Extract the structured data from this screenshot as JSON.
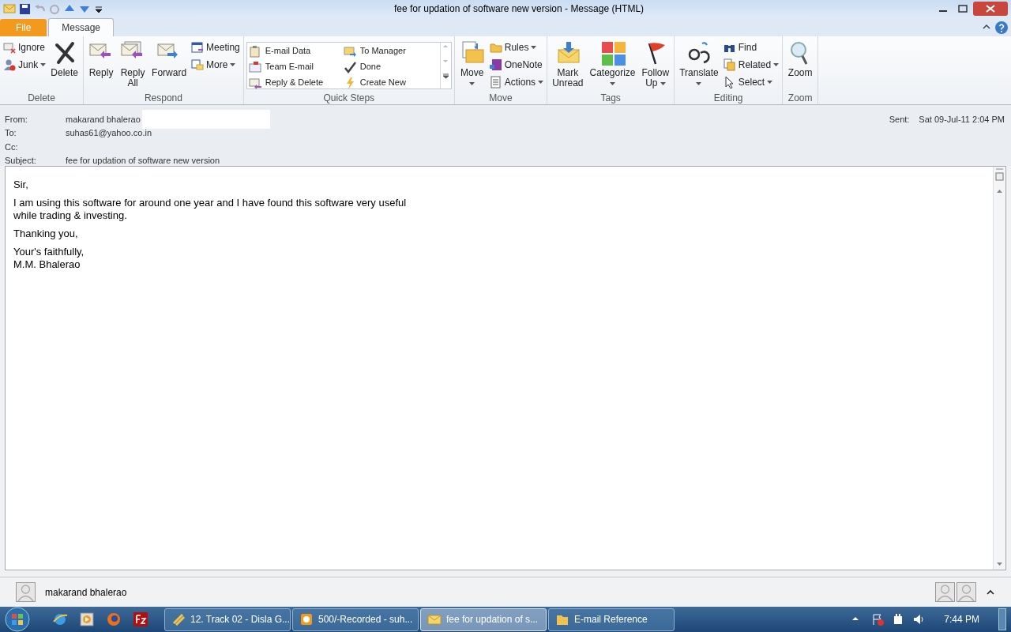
{
  "window": {
    "title": "fee for updation of software new version  -  Message (HTML)"
  },
  "tabs": [
    {
      "label": "File",
      "kind": "file",
      "selected": false
    },
    {
      "label": "Message",
      "kind": "tab",
      "selected": true
    }
  ],
  "ribbon_groups": [
    {
      "label": "Delete",
      "entries": [
        {
          "kind": "stack",
          "items": [
            {
              "label": "Ignore",
              "dropdown": false
            },
            {
              "label": "Junk",
              "dropdown": true
            }
          ]
        },
        {
          "kind": "big",
          "label": "Delete",
          "dropdown": false
        }
      ]
    },
    {
      "label": "Respond",
      "entries": [
        {
          "kind": "big",
          "label": "Reply",
          "dropdown": false
        },
        {
          "kind": "big",
          "label": "Reply All",
          "dropdown": false
        },
        {
          "kind": "big",
          "label": "Forward",
          "dropdown": false
        },
        {
          "kind": "stack",
          "items": [
            {
              "label": "Meeting",
              "dropdown": false
            },
            {
              "label": "More",
              "dropdown": true
            }
          ]
        }
      ]
    },
    {
      "label": "Quick Steps",
      "entries": [
        {
          "kind": "gallery",
          "items": [
            {
              "label": "E-mail Data"
            },
            {
              "label": "To Manager"
            },
            {
              "label": "Team E-mail"
            },
            {
              "label": "Done"
            },
            {
              "label": "Reply & Delete"
            },
            {
              "label": "Create New"
            }
          ]
        }
      ]
    },
    {
      "label": "Move",
      "entries": [
        {
          "kind": "big",
          "label": "Move",
          "dropdown": true
        },
        {
          "kind": "stack",
          "items": [
            {
              "label": "Rules",
              "dropdown": true
            },
            {
              "label": "OneNote",
              "dropdown": false
            },
            {
              "label": "Actions",
              "dropdown": true
            }
          ]
        }
      ]
    },
    {
      "label": "Tags",
      "entries": [
        {
          "kind": "big",
          "label": "Mark Unread",
          "dropdown": false
        },
        {
          "kind": "big",
          "label": "Categorize",
          "dropdown": true
        },
        {
          "kind": "big",
          "label": "Follow Up",
          "dropdown": true
        }
      ]
    },
    {
      "label": "Editing",
      "entries": [
        {
          "kind": "big",
          "label": "Translate",
          "dropdown": true
        },
        {
          "kind": "stack",
          "items": [
            {
              "label": "Find",
              "dropdown": false
            },
            {
              "label": "Related",
              "dropdown": true
            },
            {
              "label": "Select",
              "dropdown": true
            }
          ]
        }
      ]
    },
    {
      "label": "Zoom",
      "entries": [
        {
          "kind": "big",
          "label": "Zoom",
          "dropdown": false
        }
      ]
    }
  ],
  "header": {
    "fields": [
      {
        "label": "From:",
        "value": "makarand bhalerao"
      },
      {
        "label": "To:",
        "value": "suhas61@yahoo.co.in"
      },
      {
        "label": "Cc:"
      },
      {
        "label": "Subject:",
        "value": "fee for updation of software new version"
      }
    ],
    "sent": {
      "label": "Sent:",
      "value": "Sat 09-Jul-11 2:04 PM"
    }
  },
  "body": [
    [
      "Sir,"
    ],
    [
      "I am using this software for around one year and I have found this software very useful",
      "while trading & investing."
    ],
    [
      "Thanking you,"
    ],
    [
      "Your's faithfully,",
      "M.M. Bhalerao"
    ]
  ],
  "people_pane": {
    "name": "makarand bhalerao"
  },
  "taskbar": {
    "tasks": [
      {
        "label": "12. Track 02 - Disla G...",
        "selected": false
      },
      {
        "label": "500/-Recorded - suh...",
        "selected": false
      },
      {
        "label": "fee for updation of s...",
        "selected": true
      },
      {
        "label": "E-mail Reference",
        "selected": false
      }
    ],
    "clock": "7:44 PM"
  }
}
